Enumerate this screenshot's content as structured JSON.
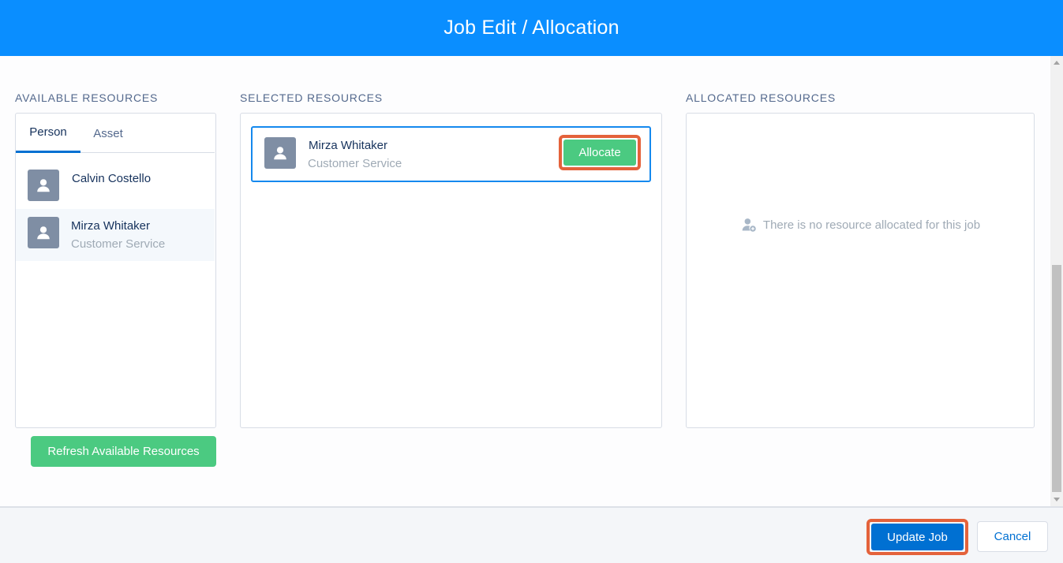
{
  "header": {
    "title": "Job Edit / Allocation"
  },
  "columns": {
    "available": {
      "title": "AVAILABLE RESOURCES",
      "tabs": [
        {
          "label": "Person"
        },
        {
          "label": "Asset"
        }
      ],
      "items": [
        {
          "name": "Calvin Costello",
          "role": ""
        },
        {
          "name": "Mirza Whitaker",
          "role": "Customer Service"
        }
      ],
      "refresh_label": "Refresh Available Resources"
    },
    "selected": {
      "title": "SELECTED RESOURCES",
      "items": [
        {
          "name": "Mirza Whitaker",
          "role": "Customer Service",
          "action_label": "Allocate"
        }
      ]
    },
    "allocated": {
      "title": "ALLOCATED RESOURCES",
      "empty_message": "There is no resource allocated for this job"
    }
  },
  "footer": {
    "update_label": "Update Job",
    "cancel_label": "Cancel"
  },
  "colors": {
    "header": "#0a8eff",
    "success": "#4bca81",
    "brand": "#0070d2",
    "highlight": "#e4623b"
  },
  "icons": {
    "avatar": "user-icon",
    "empty": "user-add-icon"
  }
}
